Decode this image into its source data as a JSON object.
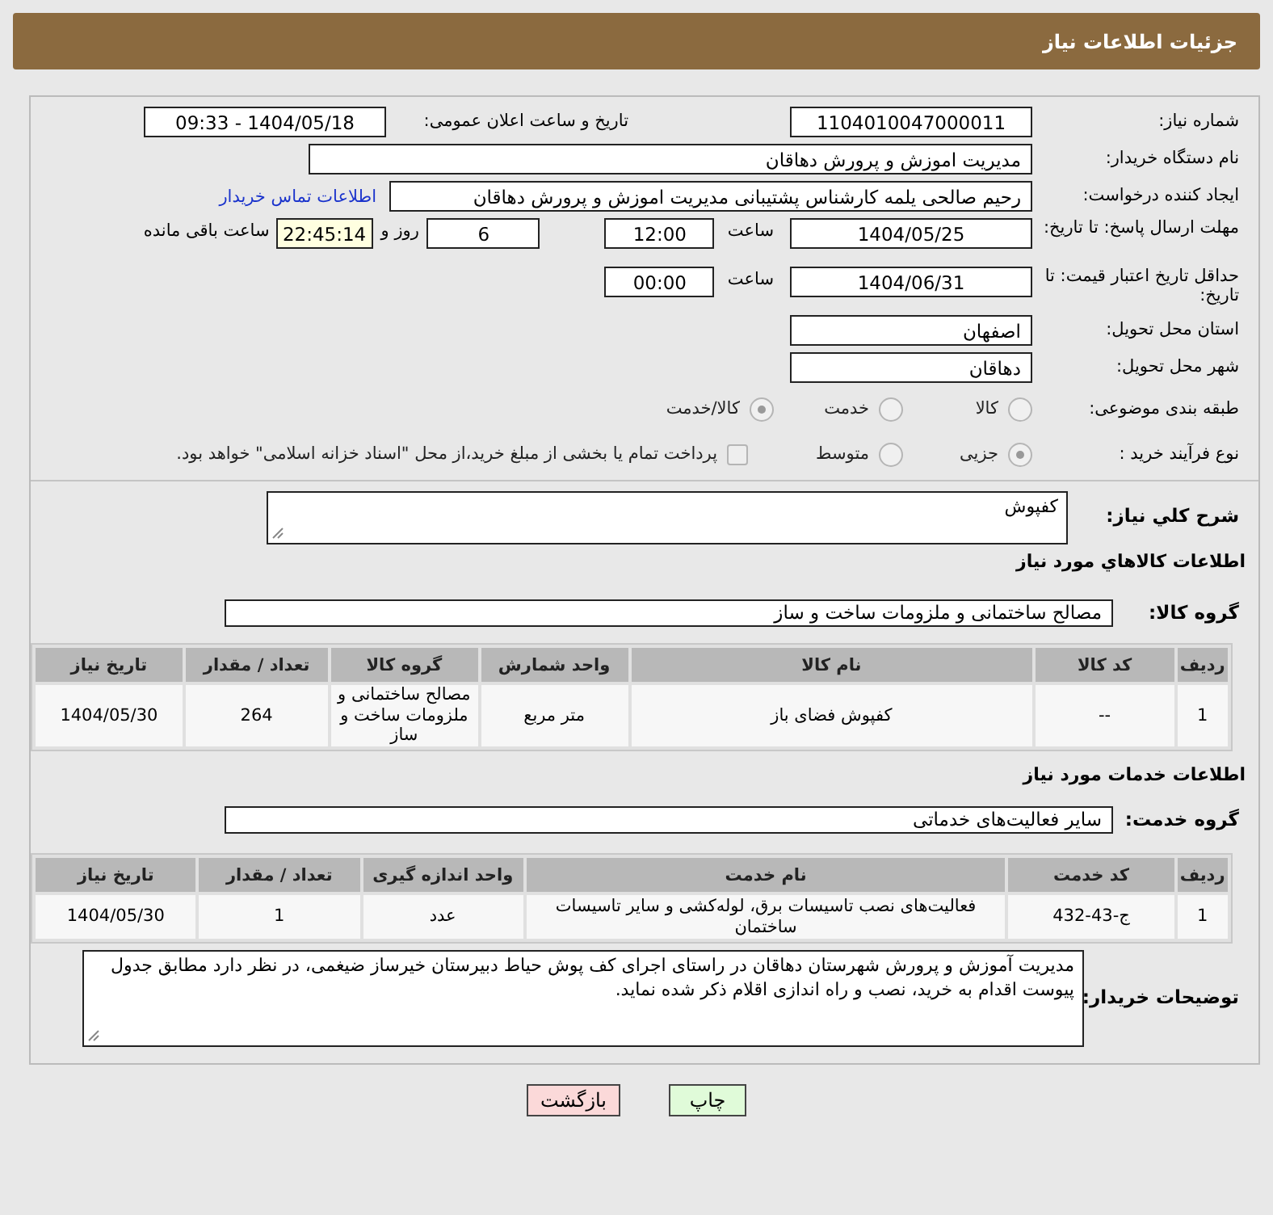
{
  "header": {
    "title": "جزئیات اطلاعات نیاز"
  },
  "need_number": {
    "label": "شماره نیاز:",
    "value": "1104010047000011"
  },
  "announce": {
    "label": "تاریخ و ساعت اعلان عمومی:",
    "value": "1404/05/18 - 09:33"
  },
  "buyer_org": {
    "label": "نام دستگاه خریدار:",
    "value": "مدیریت اموزش و پرورش دهاقان"
  },
  "requester": {
    "label": "ایجاد کننده درخواست:",
    "value": "رحیم صالحی یلمه کارشناس پشتیبانی مدیریت اموزش و پرورش دهاقان",
    "link": "اطلاعات تماس خریدار"
  },
  "deadline": {
    "label": "مهلت ارسال پاسخ: تا تاریخ:",
    "date": "1404/05/25",
    "time_label": "ساعت",
    "time": "12:00",
    "days": "6",
    "days_label": "روز و",
    "remaining": "22:45:14",
    "remaining_label": "ساعت باقی مانده"
  },
  "validity": {
    "label": "حداقل تاریخ اعتبار قیمت: تا تاریخ:",
    "date": "1404/06/31",
    "time_label": "ساعت",
    "time": "00:00"
  },
  "province": {
    "label": "استان محل تحویل:",
    "value": "اصفهان"
  },
  "city": {
    "label": "شهر محل تحویل:",
    "value": "دهاقان"
  },
  "category": {
    "label": "طبقه بندی موضوعی:",
    "options": [
      {
        "label": "کالا",
        "selected": false
      },
      {
        "label": "خدمت",
        "selected": false
      },
      {
        "label": "کالا/خدمت",
        "selected": true
      }
    ]
  },
  "process": {
    "label": "نوع فرآیند خرید :",
    "options": [
      {
        "label": "جزیی",
        "selected": true
      },
      {
        "label": "متوسط",
        "selected": false
      }
    ],
    "payment": {
      "label": "پرداخت تمام یا بخشی از مبلغ خرید،از محل \"اسناد خزانه اسلامی\" خواهد بود.",
      "checked": false
    }
  },
  "description": {
    "label": "شرح کلي نیاز:",
    "value": "کفپوش"
  },
  "goods": {
    "title": "اطلاعات کالاهاي مورد نیاز",
    "group_label": "گروه کالا:",
    "group": "مصالح ساختمانی و ملزومات ساخت و ساز",
    "columns": [
      "ردیف",
      "کد کالا",
      "نام کالا",
      "واحد شمارش",
      "گروه کالا",
      "تعداد / مقدار",
      "تاریخ نیاز"
    ],
    "rows": [
      [
        "1",
        "--",
        "کفپوش فضای باز",
        "متر مربع",
        "مصالح ساختمانی و ملزومات ساخت و ساز",
        "264",
        "1404/05/30"
      ]
    ]
  },
  "services": {
    "title": "اطلاعات خدمات مورد نیاز",
    "group_label": "گروه خدمت:",
    "group": "سایر فعالیت‌های خدماتی",
    "columns": [
      "ردیف",
      "کد خدمت",
      "نام خدمت",
      "واحد اندازه گیری",
      "تعداد / مقدار",
      "تاریخ نیاز"
    ],
    "rows": [
      [
        "1",
        "ج-43-432",
        "فعالیت‌های نصب تاسیسات برق، لوله‌کشی و سایر تاسیسات ساختمان",
        "عدد",
        "1",
        "1404/05/30"
      ]
    ]
  },
  "buyer_notes": {
    "label": "توضیحات خریدار:",
    "value": "مدیریت آموزش و پرورش شهرستان دهاقان در راستای اجرای کف پوش حیاط دبیرستان خیرساز ضیغمی، در نظر دارد مطابق جدول پیوست اقدام به خرید، نصب و راه اندازی اقلام ذکر شده نماید."
  },
  "buttons": [
    {
      "label": "چاپ",
      "kind": "print"
    },
    {
      "label": "بازگشت",
      "kind": "back"
    }
  ]
}
